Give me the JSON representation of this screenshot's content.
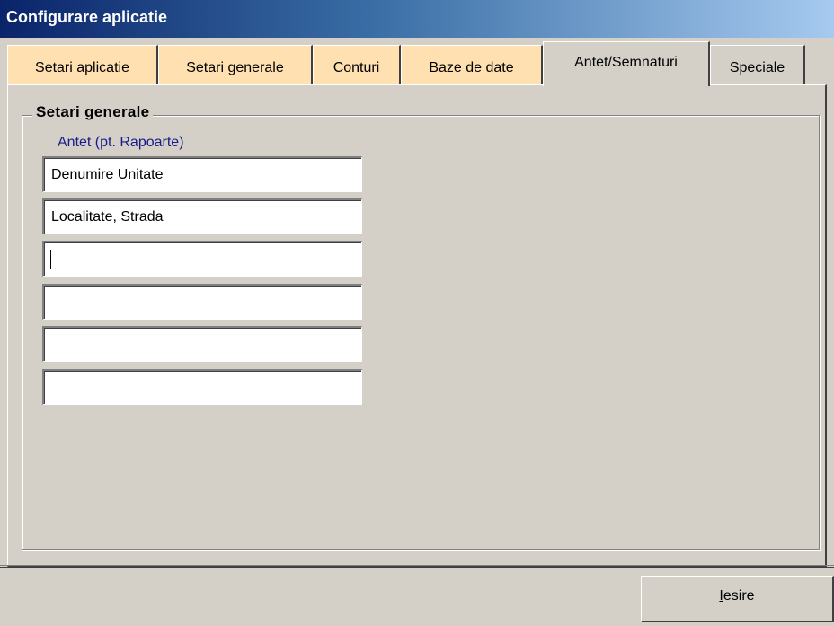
{
  "window": {
    "title": "Configurare aplicatie"
  },
  "tabs": [
    {
      "label": "Setari aplicatie"
    },
    {
      "label": "Setari generale"
    },
    {
      "label": "Conturi"
    },
    {
      "label": "Baze de date"
    },
    {
      "label": "Antet/Semnaturi",
      "active": true
    },
    {
      "label": "Speciale"
    }
  ],
  "groupbox": {
    "title": "Setari  generale",
    "subtitle": "Antet (pt. Rapoarte)",
    "fields": [
      {
        "value": "Denumire Unitate"
      },
      {
        "value": "Localitate, Strada"
      },
      {
        "value": ""
      },
      {
        "value": ""
      },
      {
        "value": ""
      },
      {
        "value": ""
      }
    ]
  },
  "footer": {
    "exit_mnemonic": "I",
    "exit_rest": "esire"
  },
  "colors": {
    "titlebar_start": "#0a246a",
    "titlebar_end": "#a6caf0",
    "tab_inactive_bg": "#ffe0b0",
    "window_bg": "#d4d0c8",
    "subtitle_text": "#1a1a8a"
  }
}
